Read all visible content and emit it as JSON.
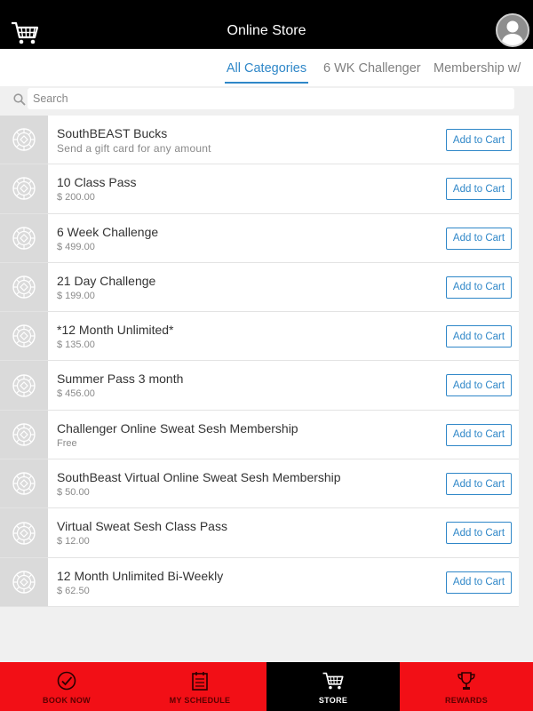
{
  "header": {
    "title": "Online Store",
    "cart_icon": "cart-icon",
    "avatar_icon": "user-avatar-icon"
  },
  "tabs": [
    {
      "label": "All Categories",
      "active": true
    },
    {
      "label": "6 WK Challenger",
      "active": false
    },
    {
      "label": "Membership w/",
      "active": false
    }
  ],
  "search": {
    "placeholder": "Search",
    "value": ""
  },
  "products": [
    {
      "name": "SouthBEAST Bucks",
      "subtitle": "Send a gift card for any amount",
      "button": "Add to Cart"
    },
    {
      "name": "10 Class Pass",
      "subtitle": "$ 200.00",
      "button": "Add to Cart"
    },
    {
      "name": "6 Week Challenge",
      "subtitle": "$ 499.00",
      "button": "Add to Cart"
    },
    {
      "name": "21 Day Challenge",
      "subtitle": "$ 199.00",
      "button": "Add to Cart"
    },
    {
      "name": "*12 Month Unlimited*",
      "subtitle": "$ 135.00",
      "button": "Add to Cart"
    },
    {
      "name": "Summer Pass 3 month",
      "subtitle": "$ 456.00",
      "button": "Add to Cart"
    },
    {
      "name": "Challenger Online Sweat Sesh Membership",
      "subtitle": "Free",
      "button": "Add to Cart"
    },
    {
      "name": "SouthBeast Virtual Online Sweat Sesh Membership",
      "subtitle": "$ 50.00",
      "button": "Add to Cart"
    },
    {
      "name": "Virtual Sweat Sesh Class Pass",
      "subtitle": "$ 12.00",
      "button": "Add to Cart"
    },
    {
      "name": "12 Month Unlimited Bi-Weekly",
      "subtitle": "$ 62.50",
      "button": "Add to Cart"
    }
  ],
  "bottom_nav": [
    {
      "label": "BOOK NOW",
      "icon": "check-circle-icon",
      "active": false
    },
    {
      "label": "MY SCHEDULE",
      "icon": "calendar-icon",
      "active": false
    },
    {
      "label": "STORE",
      "icon": "cart-icon",
      "active": true
    },
    {
      "label": "REWARDS",
      "icon": "trophy-icon",
      "active": false
    }
  ],
  "colors": {
    "accent": "#2f87c8",
    "nav_red": "#f20f16",
    "header_bg": "#000000"
  }
}
